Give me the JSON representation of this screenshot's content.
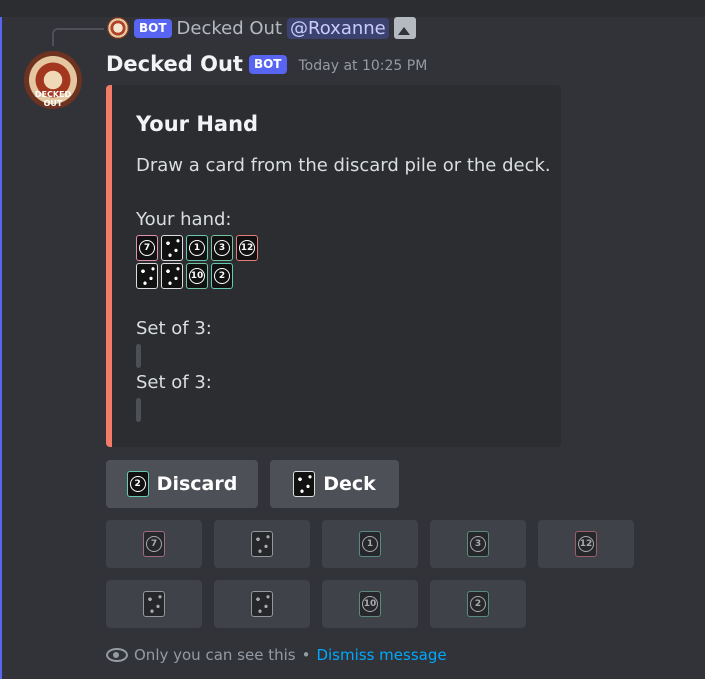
{
  "reply": {
    "bot_badge": "BOT",
    "author": "Decked Out",
    "mention": "@Roxanne"
  },
  "message": {
    "author": "Decked Out",
    "bot_badge": "BOT",
    "timestamp": "Today at 10:25 PM",
    "avatar_text": "DECKED OUT"
  },
  "embed": {
    "accent": "#f47b67",
    "title": "Your Hand",
    "description": "Draw a card from the discard pile or the deck.",
    "hand_label": "Your hand:",
    "hand_row1": [
      {
        "label": "7",
        "color": "pink"
      },
      {
        "label": "",
        "color": "wild"
      },
      {
        "label": "1",
        "color": "teal"
      },
      {
        "label": "3",
        "color": "green"
      },
      {
        "label": "12",
        "color": "red"
      }
    ],
    "hand_row2": [
      {
        "label": "",
        "color": "wild"
      },
      {
        "label": "",
        "color": "wild"
      },
      {
        "label": "10",
        "color": "green"
      },
      {
        "label": "2",
        "color": "teal"
      }
    ],
    "set1_label": "Set of 3:",
    "set2_label": "Set of 3:"
  },
  "buttons": {
    "discard": {
      "label": "Discard",
      "card": "2"
    },
    "deck": {
      "label": "Deck"
    }
  },
  "card_buttons_row1": [
    "7",
    "wild",
    "1",
    "3",
    "12"
  ],
  "card_buttons_row2": [
    "wild",
    "wild",
    "10",
    "2"
  ],
  "footer": {
    "only_you": "Only you can see this",
    "separator": "•",
    "dismiss": "Dismiss message"
  }
}
